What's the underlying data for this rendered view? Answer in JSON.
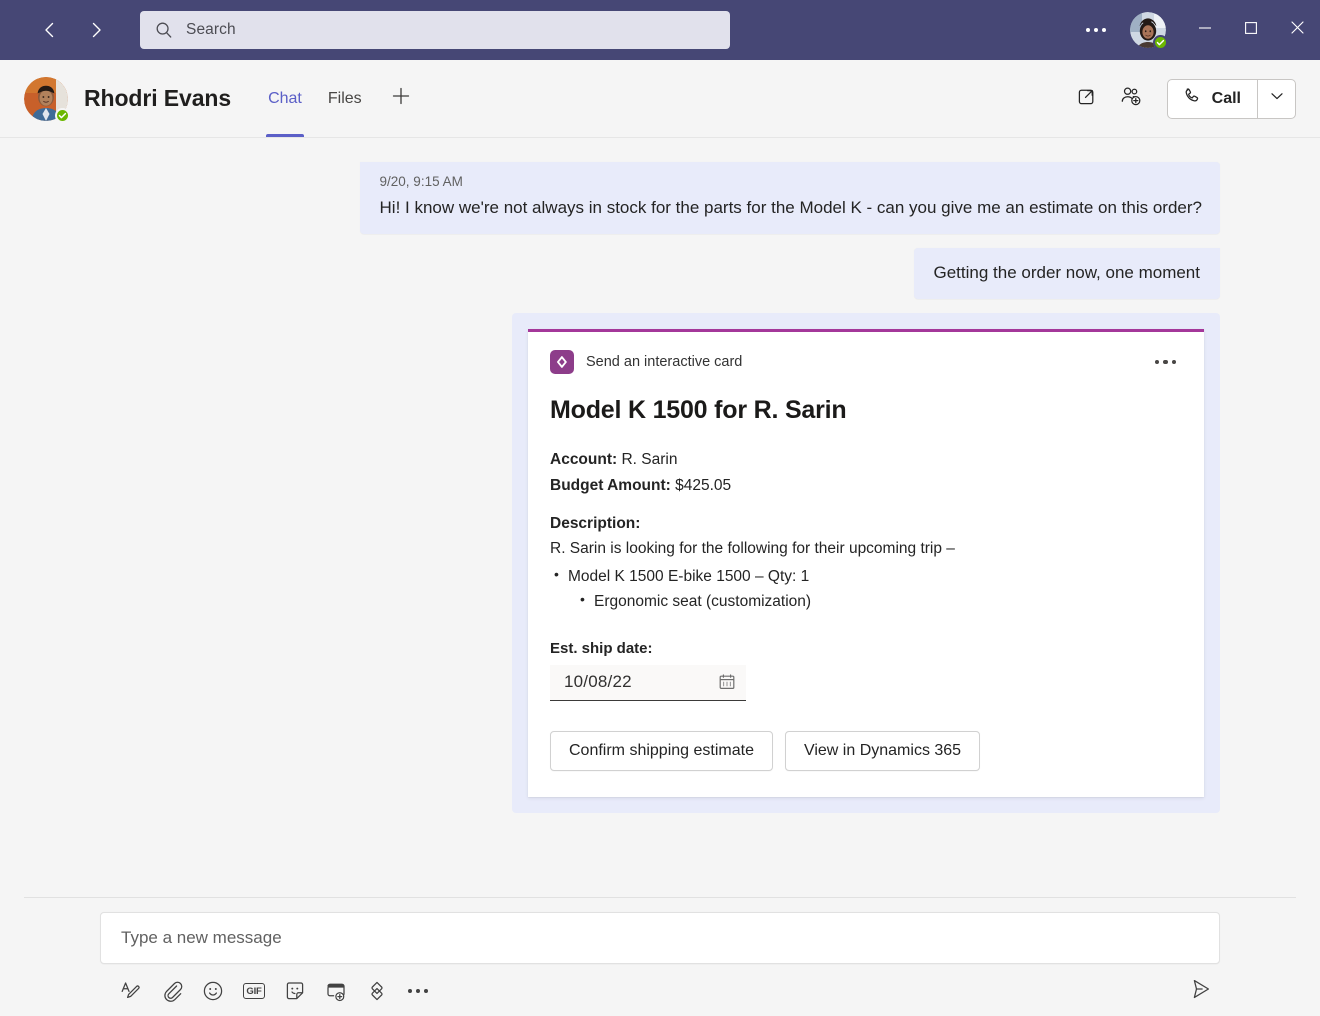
{
  "titlebar": {
    "back_label": "Back",
    "forward_label": "Forward",
    "search": {
      "placeholder": "Search",
      "value": ""
    },
    "more_label": "Settings and more",
    "account_name": "Current user",
    "presence": "Available",
    "minimize_label": "Minimize",
    "maximize_label": "Maximize",
    "close_label": "Close"
  },
  "chat_header": {
    "contact_name": "Rhodri Evans",
    "presence": "Available",
    "tabs": [
      {
        "label": "Chat",
        "active": true
      },
      {
        "label": "Files",
        "active": false
      }
    ],
    "add_tab_label": "+",
    "popout_label": "Pop out chat",
    "add_people_label": "Add people",
    "call_label": "Call",
    "call_caret_label": "Call options"
  },
  "conversation": {
    "messages": [
      {
        "direction": "incoming",
        "time": "9/20, 9:15 AM",
        "text": "Hi! I know we're not always in stock for the parts for the Model K - can you give me an estimate on this order?"
      },
      {
        "direction": "outgoing",
        "time": "",
        "text": "Getting the order now, one moment"
      }
    ]
  },
  "card": {
    "app_name": "Send an interactive card",
    "app_icon": "power-apps-icon",
    "overflow_label": "More options",
    "title": "Model K 1500 for R. Sarin",
    "fields": [
      {
        "label": "Account:",
        "value": "R. Sarin"
      },
      {
        "label": "Budget Amount:",
        "value": "$425.05"
      }
    ],
    "description_label": "Description:",
    "description_text": "R. Sarin is looking for the following for their upcoming trip –",
    "bullets": [
      {
        "text": "Model K 1500 E-bike 1500 – Qty: 1",
        "level": 1
      },
      {
        "text": "Ergonomic seat (customization)",
        "level": 2
      }
    ],
    "date_label": "Est. ship date:",
    "date_value": "10/08/22",
    "date_icon": "calendar-icon",
    "actions": [
      {
        "label": "Confirm shipping estimate"
      },
      {
        "label": "View in Dynamics 365"
      }
    ],
    "accent_color": "#a4379a"
  },
  "compose": {
    "placeholder": "Type a new message",
    "value": "",
    "tools": [
      {
        "name": "format-icon",
        "label": "Format"
      },
      {
        "name": "attach-icon",
        "label": "Attach file"
      },
      {
        "name": "emoji-icon",
        "label": "Emoji"
      },
      {
        "name": "gif-icon",
        "label": "GIF"
      },
      {
        "name": "sticker-icon",
        "label": "Sticker"
      },
      {
        "name": "schedule-meeting-icon",
        "label": "Schedule a meeting"
      },
      {
        "name": "loop-component-icon",
        "label": "Loop component"
      },
      {
        "name": "more-options-icon",
        "label": "More options"
      }
    ],
    "gif_text": "GIF",
    "send_label": "Send"
  },
  "colors": {
    "titlebar": "#464775",
    "accent": "#5b5fc7",
    "bubble": "#e8ebfa",
    "background": "#f5f5f5",
    "card_accent": "#a4379a",
    "presence_green": "#6bb700"
  }
}
